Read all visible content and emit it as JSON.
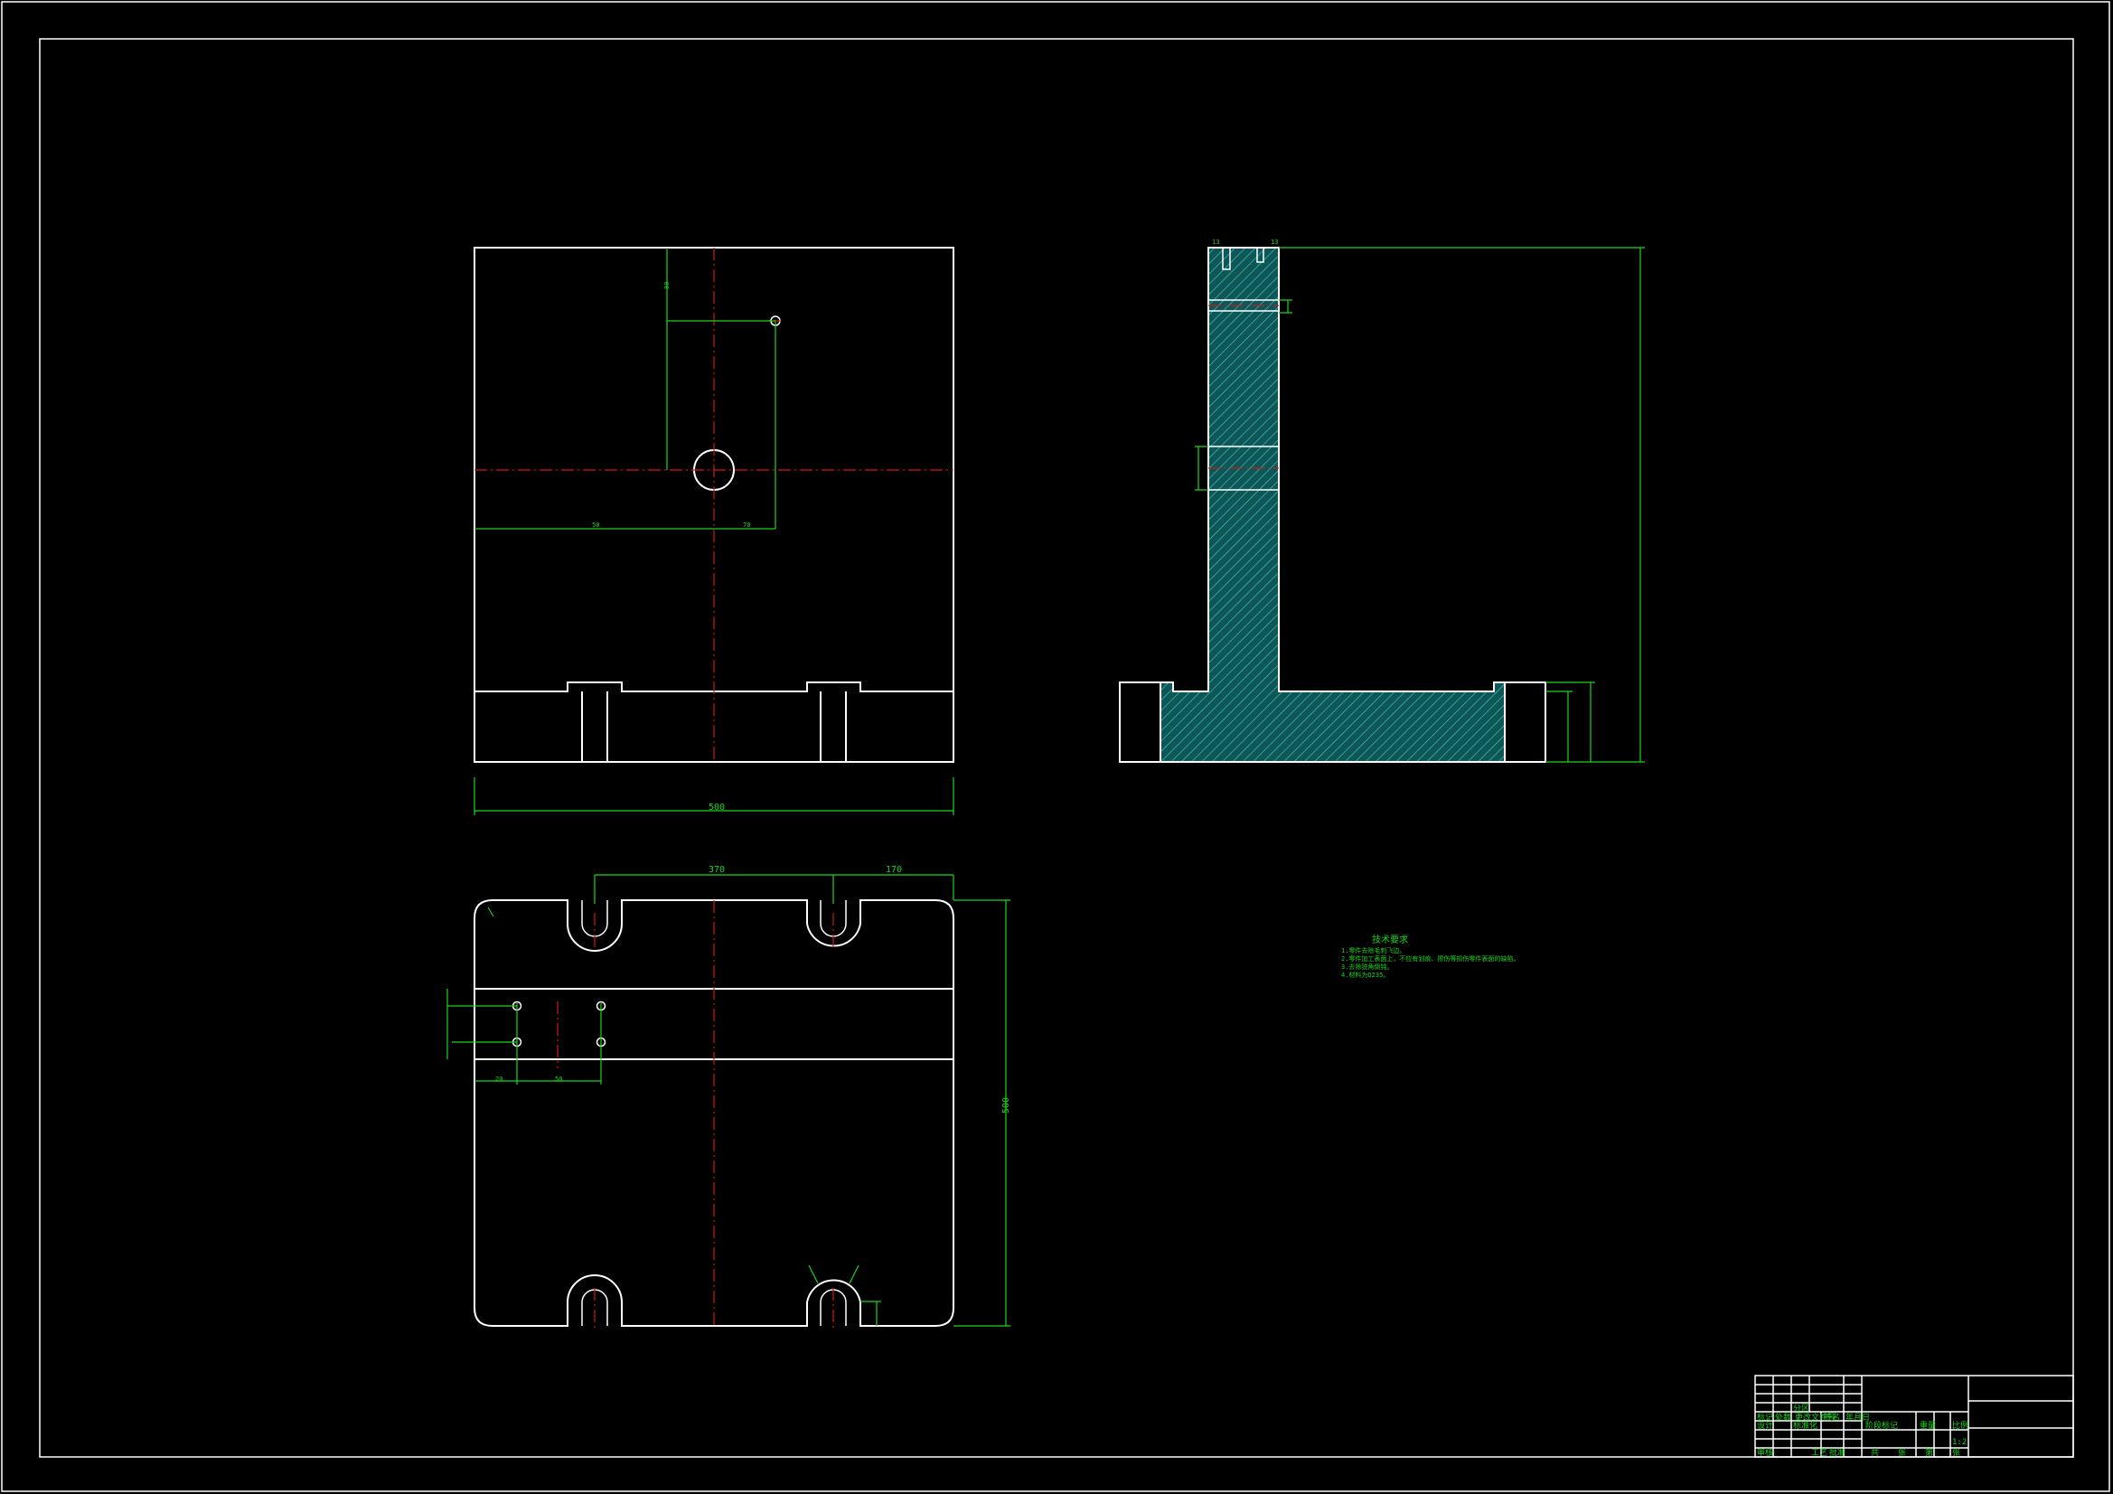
{
  "dimensions": {
    "front_width": "500",
    "plan_span_top_left": "370",
    "plan_span_top_right": "170",
    "plan_height": "500"
  },
  "notes": {
    "title": "技术要求",
    "lines": [
      "1.零件去除毛刺飞边。",
      "2.零件加工表面上，不应有划痕、擦伤等损伤零件表面的缺陷。",
      "3.去除锐角倒钝。",
      "4.材料为Q235。"
    ]
  },
  "title_block": {
    "row_labels": [
      "标记",
      "处数",
      "分区",
      "更改文件号",
      "签名",
      "年月日"
    ],
    "row_labels_2": [
      "设计",
      "标准化",
      "阶段标记",
      "重量",
      "比例"
    ],
    "scale": "1:2",
    "row_labels_3": [
      "审核",
      "工艺",
      "批准",
      "共",
      "张",
      "第",
      "张"
    ]
  },
  "colors": {
    "outline": "#ffffff",
    "dimension": "#19d61a",
    "centerline": "#d41515",
    "hatch": "#2bb3b0",
    "background": "#000000"
  }
}
